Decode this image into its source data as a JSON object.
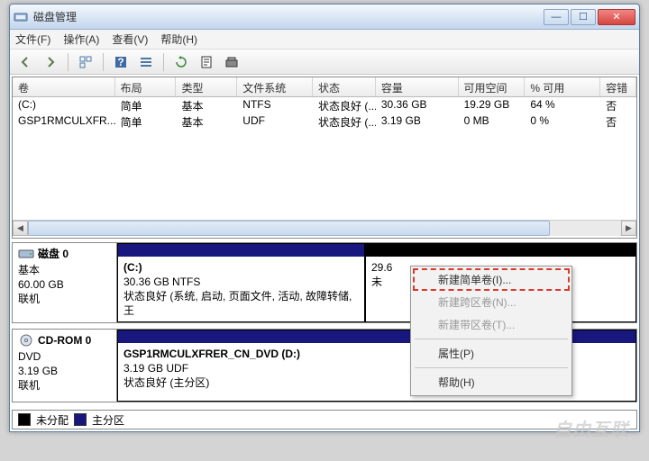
{
  "window": {
    "title": "磁盘管理"
  },
  "menu": {
    "file": "文件(F)",
    "action": "操作(A)",
    "view": "查看(V)",
    "help": "帮助(H)"
  },
  "columns": {
    "volume": "卷",
    "layout": "布局",
    "type": "类型",
    "fs": "文件系统",
    "status": "状态",
    "capacity": "容量",
    "free": "可用空间",
    "pct": "% 可用",
    "fault": "容错"
  },
  "volumes": [
    {
      "name": "(C:)",
      "layout": "简单",
      "type": "基本",
      "fs": "NTFS",
      "status": "状态良好 (...",
      "capacity": "30.36 GB",
      "free": "19.29 GB",
      "pct": "64 %",
      "fault": "否"
    },
    {
      "name": "GSP1RMCULXFR...",
      "layout": "简单",
      "type": "基本",
      "fs": "UDF",
      "status": "状态良好 (...",
      "capacity": "3.19 GB",
      "free": "0 MB",
      "pct": "0 %",
      "fault": "否"
    }
  ],
  "disk0": {
    "title": "磁盘 0",
    "type": "基本",
    "size": "60.00 GB",
    "state": "联机",
    "partC": {
      "name": "(C:)",
      "size": "30.36 GB NTFS",
      "status": "状态良好 (系统, 启动, 页面文件, 活动, 故障转储, 王"
    },
    "unalloc": {
      "size": "29.6",
      "status": "未"
    }
  },
  "cdrom": {
    "title": "CD-ROM 0",
    "type": "DVD",
    "size": "3.19 GB",
    "state": "联机",
    "vol": {
      "name": "GSP1RMCULXFRER_CN_DVD  (D:)",
      "size": "3.19 GB UDF",
      "status": "状态良好 (主分区)"
    }
  },
  "legend": {
    "unalloc": "未分配",
    "primary": "主分区"
  },
  "context": {
    "newSimple": "新建简单卷(I)...",
    "newSpanned": "新建跨区卷(N)...",
    "newStriped": "新建带区卷(T)...",
    "properties": "属性(P)",
    "help": "帮助(H)"
  },
  "watermark": "自由互联"
}
